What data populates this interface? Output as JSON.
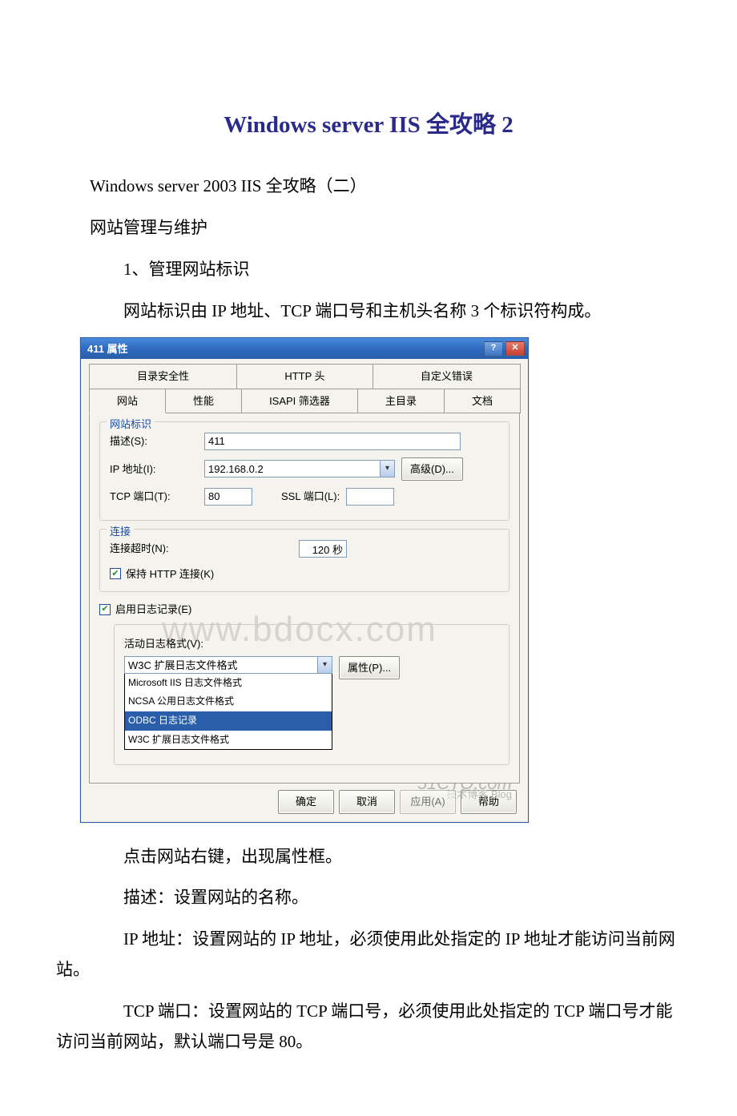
{
  "doc": {
    "title": "Windows server IIS 全攻略 2",
    "p1": "Windows server 2003 IIS 全攻略（二）",
    "p2": "网站管理与维护",
    "p3": "1、管理网站标识",
    "p4": "网站标识由 IP 地址、TCP 端口号和主机头名称 3 个标识符构成。",
    "p5": "点击网站右键，出现属性框。",
    "p6": "描述：设置网站的名称。",
    "p7": "IP 地址：设置网站的 IP 地址，必须使用此处指定的 IP 地址才能访问当前网站。",
    "p8": "TCP 端口：设置网站的 TCP 端口号，必须使用此处指定的 TCP 端口号才能访问当前网站，默认端口号是 80。"
  },
  "dialog": {
    "title": "411 属性",
    "tabs1": {
      "t0": "目录安全性",
      "t1": "HTTP 头",
      "t2": "自定义错误"
    },
    "tabs2": {
      "t0": "网站",
      "t1": "性能",
      "t2": "ISAPI 筛选器",
      "t3": "主目录",
      "t4": "文档"
    },
    "site_id": {
      "legend": "网站标识",
      "desc_label": "描述(S):",
      "desc_value": "411",
      "ip_label": "IP 地址(I):",
      "ip_value": "192.168.0.2",
      "adv_btn": "高级(D)...",
      "tcp_label": "TCP 端口(T):",
      "tcp_value": "80",
      "ssl_label": "SSL 端口(L):",
      "ssl_value": ""
    },
    "conn": {
      "legend": "连接",
      "timeout_label": "连接超时(N):",
      "timeout_value": "120 秒",
      "keep_http": "保持 HTTP 连接(K)"
    },
    "log": {
      "enable": "启用日志记录(E)",
      "format_label": "活动日志格式(V):",
      "selected": "W3C 扩展日志文件格式",
      "prop_btn": "属性(P)...",
      "opt0": "Microsoft IIS 日志文件格式",
      "opt1": "NCSA 公用日志文件格式",
      "opt2": "ODBC 日志记录",
      "opt3": "W3C 扩展日志文件格式"
    },
    "buttons": {
      "ok": "确定",
      "cancel": "取消",
      "apply": "应用(A)",
      "help": "帮助"
    },
    "wm_big": "www.bdocx.com",
    "wm1": "51CTO.com",
    "wm2": "技术博客 Blog"
  }
}
